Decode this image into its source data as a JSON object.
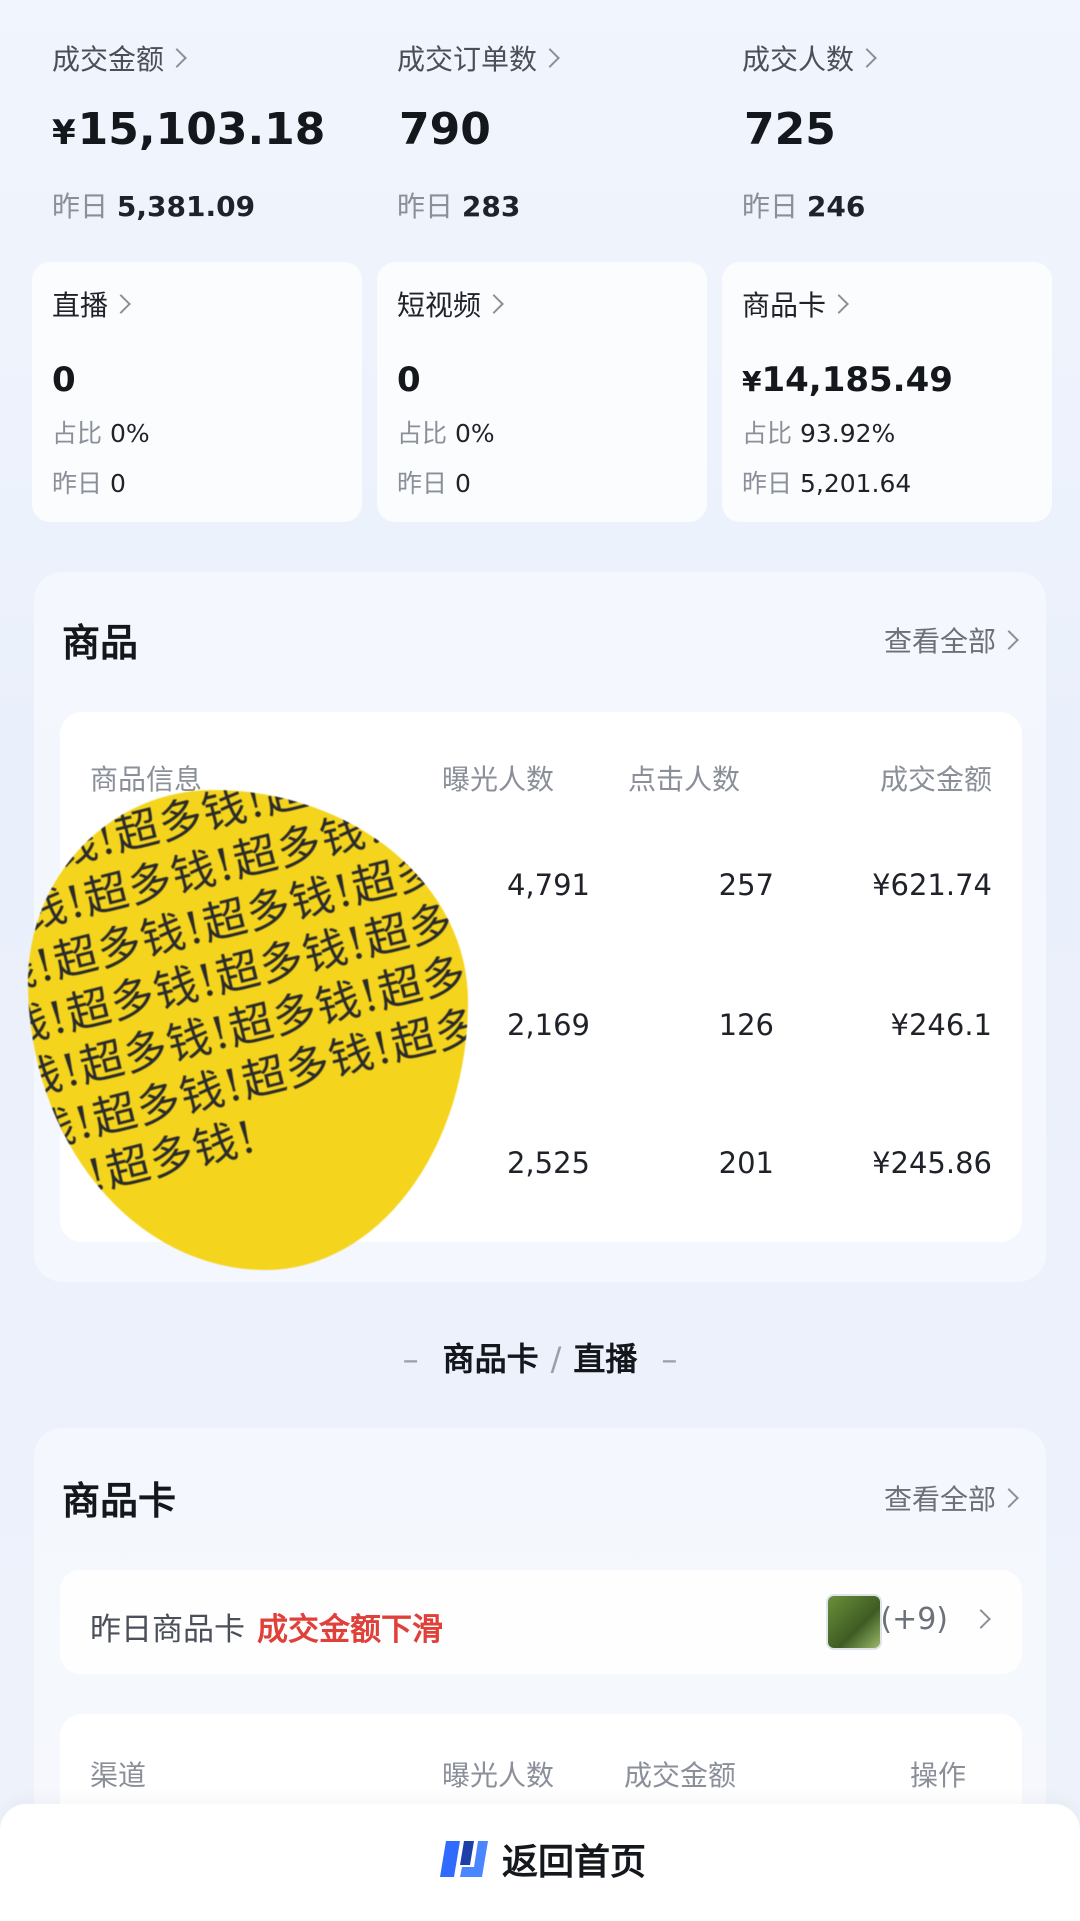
{
  "metrics": [
    {
      "label": "成交金额",
      "currency": "¥",
      "value": "15,103.18",
      "yesterday_label": "昨日",
      "yesterday": "5,381.09"
    },
    {
      "label": "成交订单数",
      "currency": "",
      "value": "790",
      "yesterday_label": "昨日",
      "yesterday": "283"
    },
    {
      "label": "成交人数",
      "currency": "",
      "value": "725",
      "yesterday_label": "昨日",
      "yesterday": "246"
    }
  ],
  "channels": [
    {
      "label": "直播",
      "currency": "",
      "value": "0",
      "share_label": "占比",
      "share": "0%",
      "yesterday_label": "昨日",
      "yesterday": "0"
    },
    {
      "label": "短视频",
      "currency": "",
      "value": "0",
      "share_label": "占比",
      "share": "0%",
      "yesterday_label": "昨日",
      "yesterday": "0"
    },
    {
      "label": "商品卡",
      "currency": "¥",
      "value": "14,185.49",
      "share_label": "占比",
      "share": "93.92%",
      "yesterday_label": "昨日",
      "yesterday": "5,201.64"
    }
  ],
  "products": {
    "title": "商品",
    "view_all": "查看全部",
    "columns": [
      "商品信息",
      "曝光人数",
      "点击人数",
      "成交金额"
    ],
    "rows": [
      {
        "exposure": "4,791",
        "clicks": "257",
        "amount": "¥621.74"
      },
      {
        "exposure": "2,169",
        "clicks": "126",
        "amount": "¥246.1"
      },
      {
        "exposure": "2,525",
        "clicks": "201",
        "amount": "¥245.86"
      }
    ],
    "censor_text": "超多钱!超多钱!超多钱!超多钱!超多钱!超多钱!超多钱!超多钱!超多钱!超多钱!超多钱!超多钱!超多钱!超多钱!超多钱!超多钱!超多钱!超多钱!超多钱!超多钱!"
  },
  "switcher": {
    "left": "商品卡",
    "separator": "/",
    "right": "直播",
    "dash": "–"
  },
  "product_card": {
    "title": "商品卡",
    "view_all": "查看全部",
    "alert_prefix": "昨日商品卡",
    "alert_warning": "成交金额下滑",
    "more_count": "(+9)",
    "columns": [
      "渠道",
      "曝光人数",
      "成交金额",
      "操作"
    ]
  },
  "bottom": {
    "home_label": "返回首页"
  },
  "colors": {
    "warning": "#e0403a",
    "censor": "#f4d41c",
    "brand_blue": "#2f6bff"
  }
}
